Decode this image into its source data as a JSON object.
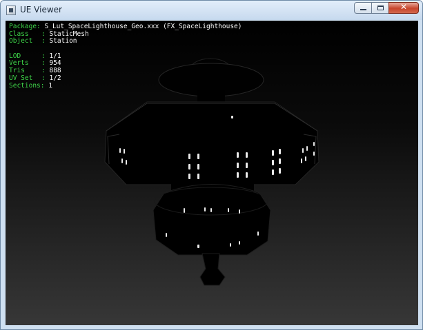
{
  "window": {
    "title": "UE Viewer",
    "icon": "app-icon",
    "close_glyph": "✕"
  },
  "info": {
    "package_label": "Package:",
    "package_value": "S_Lut_SpaceLighthouse_Geo.xxx (FX_SpaceLighthouse)",
    "class_label": "Class",
    "class_value": "StaticMesh",
    "object_label": "Object",
    "object_value": "Station",
    "lod_label": "LOD",
    "lod_value": "1/1",
    "verts_label": "Verts",
    "verts_value": "954",
    "tris_label": "Tris",
    "tris_value": "888",
    "uvset_label": "UV Set",
    "uvset_value": "1/2",
    "sections_label": "Sections:",
    "sections_value": "1",
    "separator": ":"
  },
  "colors": {
    "label_green": "#3fd84a",
    "value_white": "#ffffff"
  }
}
